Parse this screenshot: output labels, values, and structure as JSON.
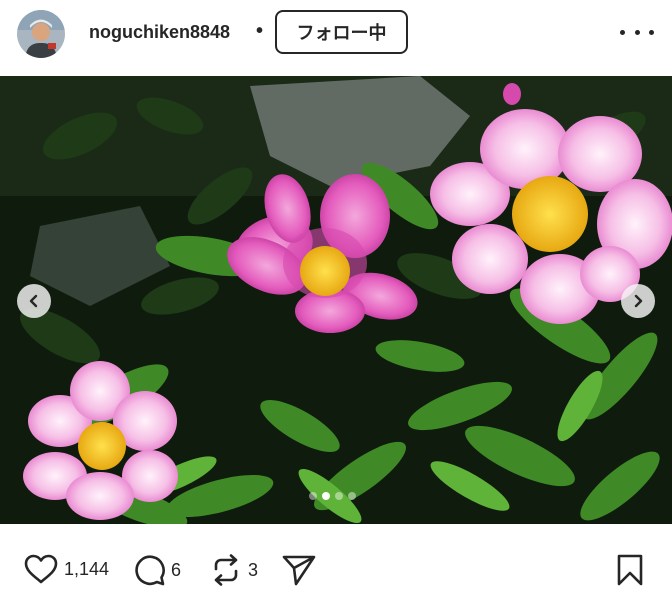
{
  "post": {
    "username": "noguchiken8848",
    "separator": "•",
    "follow_label": "フォロー中",
    "more_icon": "more-horizontal-icon",
    "carousel": {
      "total_slides": 4,
      "active_slide": 2
    }
  },
  "actions": {
    "likes": "1,144",
    "comments": "6",
    "reposts": "3"
  },
  "colors": {
    "text": "#262626",
    "background": "#ffffff",
    "flower_pink": "#e85fbf",
    "flower_center": "#f6c324",
    "foliage": "#2f6e1f"
  }
}
